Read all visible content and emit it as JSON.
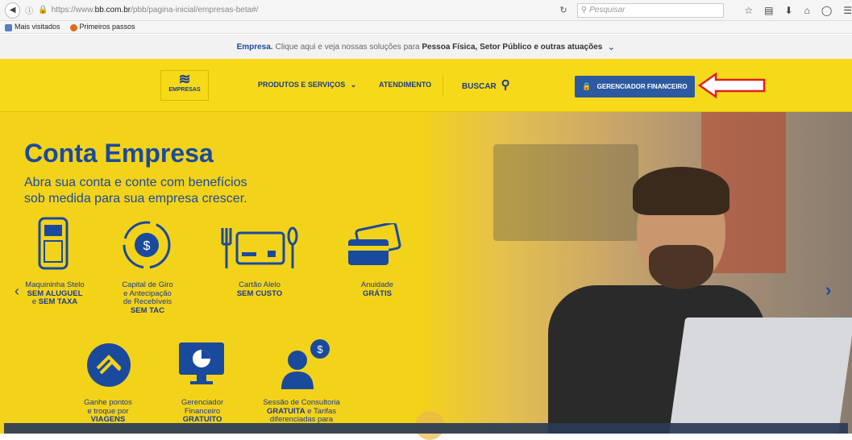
{
  "browser": {
    "url_prefix": "https://www.",
    "url_domain": "bb.com.br",
    "url_path": "/pbb/pagina-inicial/empresas-beta#/",
    "search_placeholder": "Pesquisar",
    "bookmarks": [
      "Mais visitados",
      "Primeiros passos"
    ]
  },
  "topstrip": {
    "brand": "Empresa.",
    "text": "Clique aqui e veja nossas soluções para",
    "bold": "Pessoa Física, Setor Público e outras atuações"
  },
  "header": {
    "logo_word": "EMPRESAS",
    "menu_products": "PRODUTOS E SERVIÇOS",
    "menu_service": "ATENDIMENTO",
    "menu_search": "BUSCAR",
    "cta": "GERENCIADOR FINANCEIRO"
  },
  "hero": {
    "title": "Conta Empresa",
    "subtitle_1": "Abra sua conta e conte com benefícios",
    "subtitle_2": "sob medida para sua empresa crescer.",
    "features": [
      {
        "l1": "Maquininha Stelo",
        "b1": "SEM ALUGUEL",
        "l2": "e",
        "b2": "SEM TAXA"
      },
      {
        "l1": "Capital de Giro",
        "l2": "e Antecipação",
        "l3": "de Recebíveis",
        "b1": "SEM TAC"
      },
      {
        "l1": "Cartão Alelo",
        "b1": "SEM CUSTO"
      },
      {
        "l1": "Anuidade",
        "b1": "GRÁTIS"
      },
      {
        "l1": "Ganhe pontos",
        "l2": "e troque por",
        "b1": "VIAGENS"
      },
      {
        "l1": "Gerenciador",
        "l2": "Financeiro",
        "b1": "GRATUITO"
      },
      {
        "l1": "Sessão de Consultoria",
        "b1": "GRATUITA",
        "l2": "e Tarifas",
        "l3": "diferenciadas para"
      }
    ]
  },
  "colors": {
    "brand_blue": "#1a4a9e",
    "brand_yellow": "#f6d919",
    "button_blue": "#2c5aa0",
    "arrow_red": "#e02020"
  }
}
